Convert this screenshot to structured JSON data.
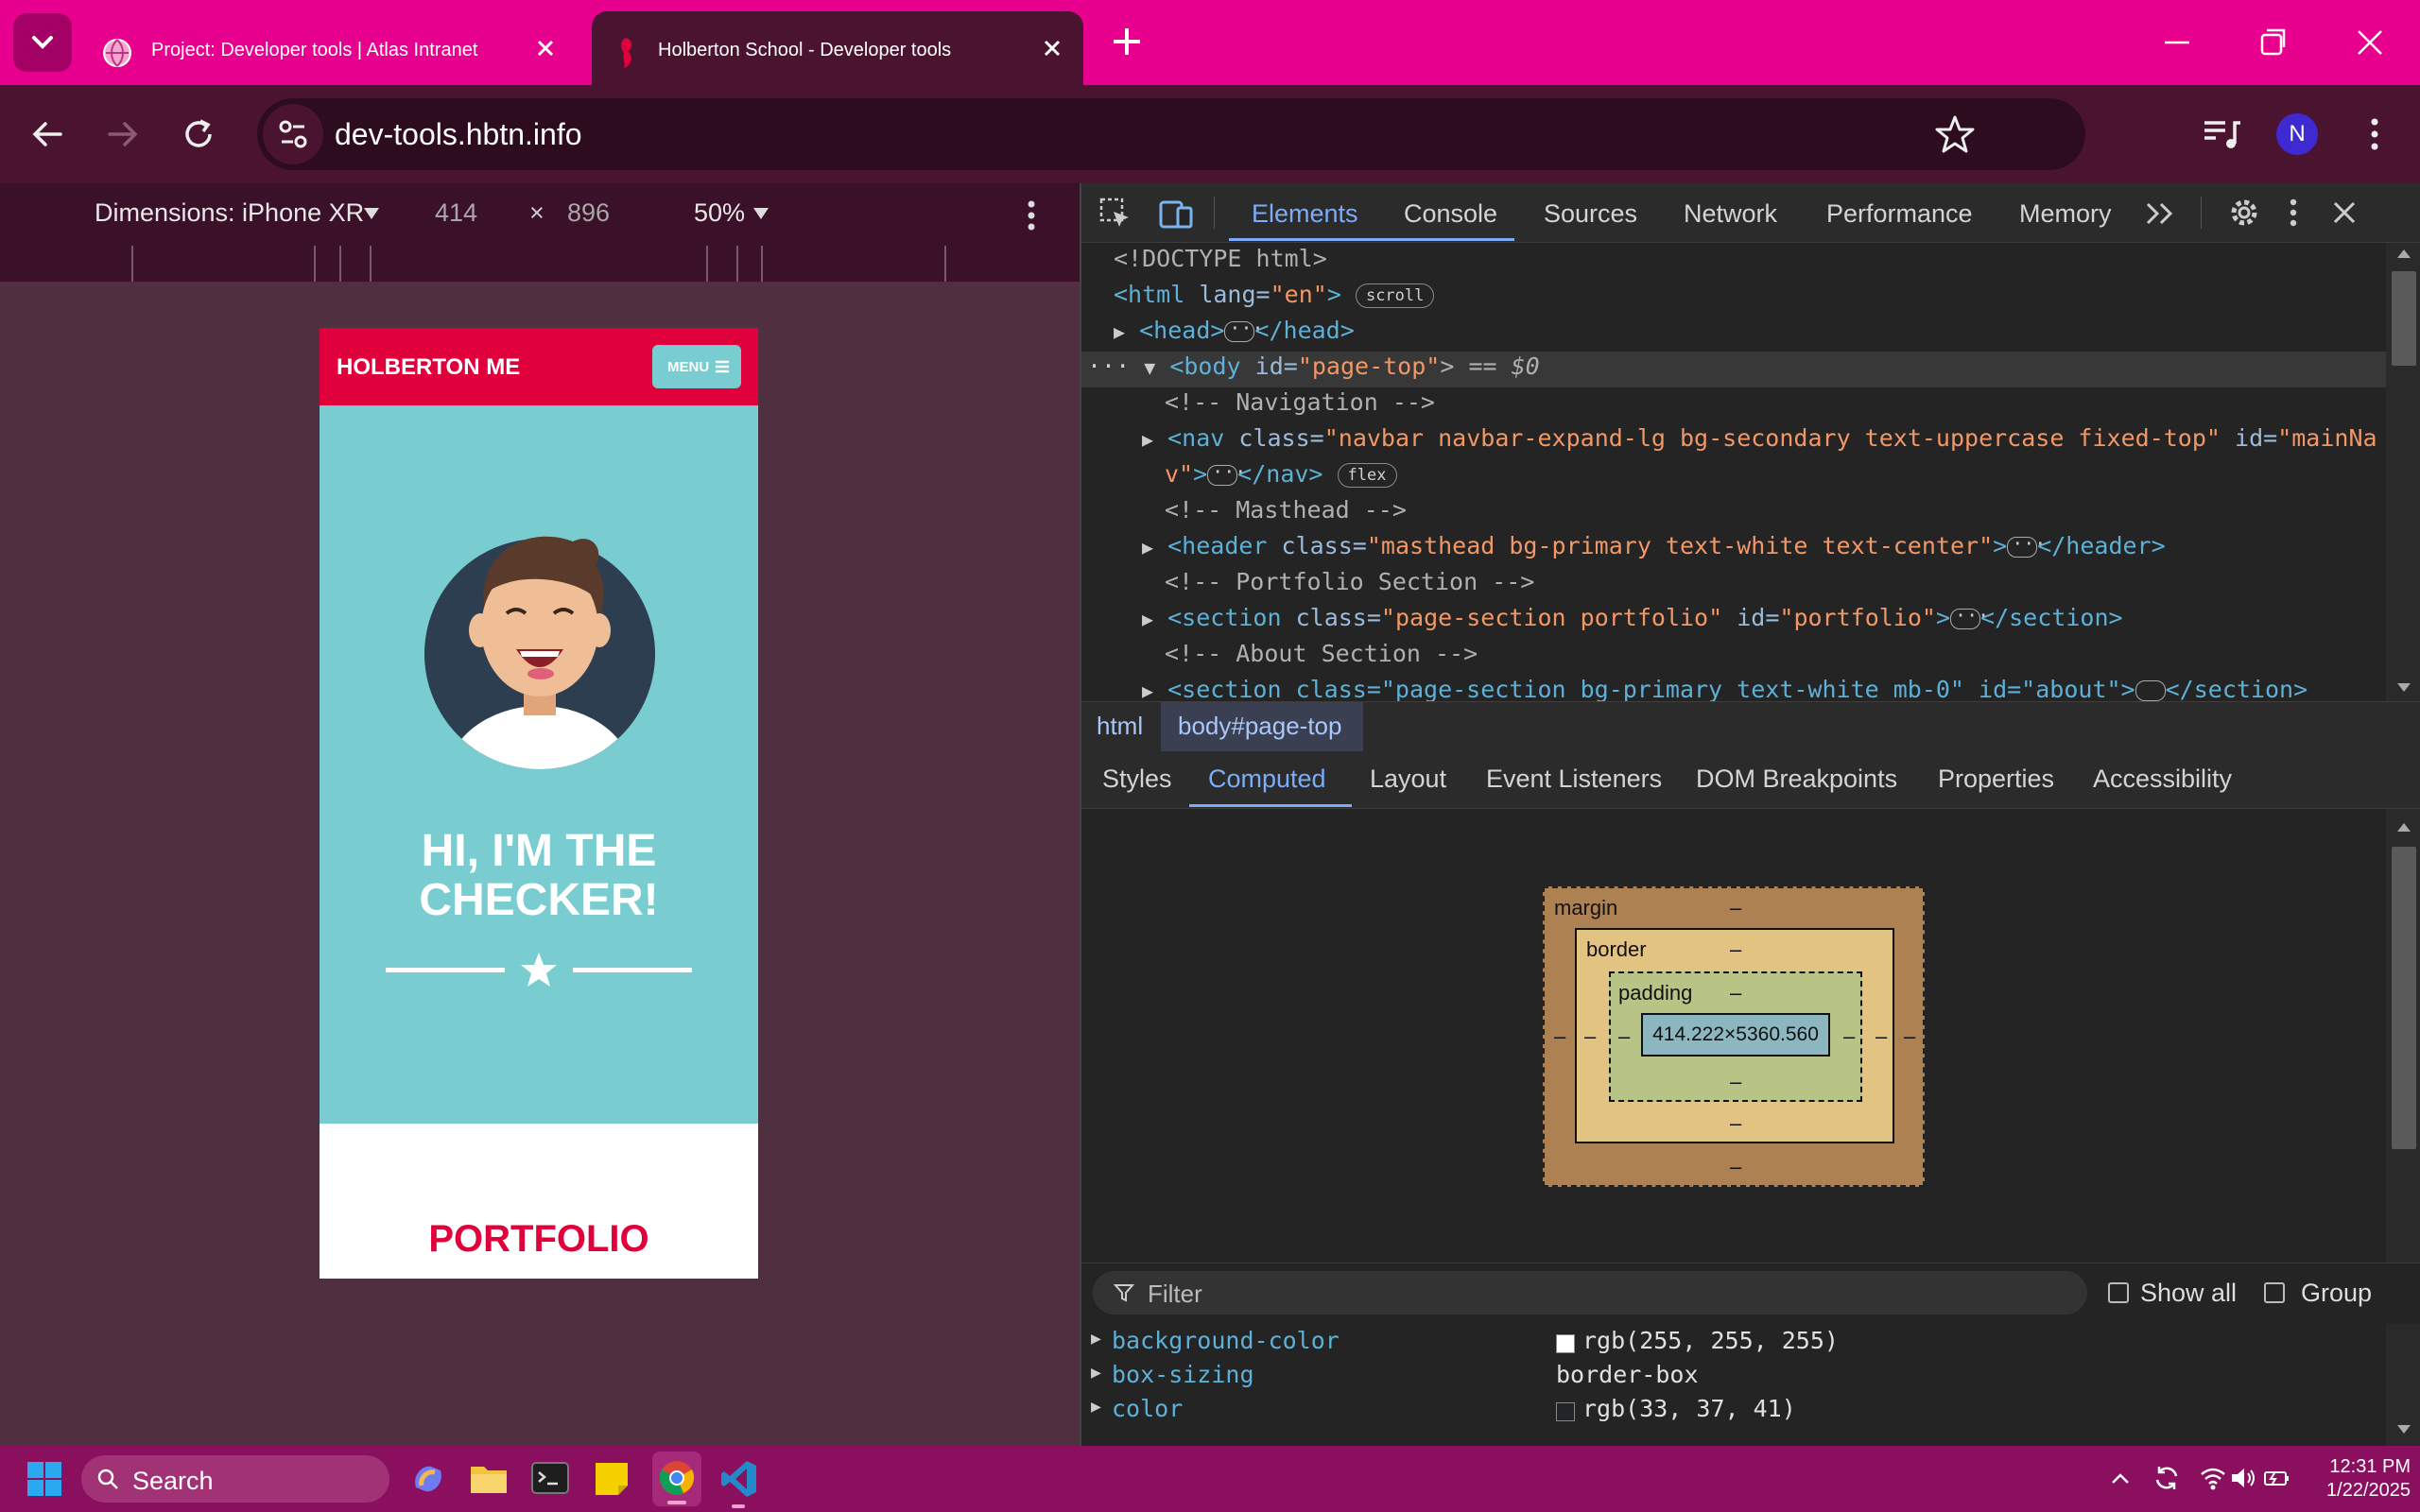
{
  "browser": {
    "tabs": [
      {
        "title": "Project: Developer tools | Atlas Intranet"
      },
      {
        "title": "Holberton School - Developer tools"
      }
    ],
    "url": "dev-tools.hbtn.info",
    "profile_initial": "N"
  },
  "device_toolbar": {
    "dimensions_label": "Dimensions: iPhone XR",
    "width": "414",
    "times": "×",
    "height": "896",
    "zoom": "50%"
  },
  "phone": {
    "brand": "HOLBERTON ME",
    "menu": "MENU",
    "hero_line1": "HI, I'M THE",
    "hero_line2": "CHECKER!",
    "portfolio": "PORTFOLIO"
  },
  "devtools": {
    "tabs": [
      "Elements",
      "Console",
      "Sources",
      "Network",
      "Performance",
      "Memory"
    ],
    "dom": {
      "doctype": "<!DOCTYPE html>",
      "html_open": "<html",
      "html_lang_attr": "lang",
      "html_lang_val": "\"en\"",
      "html_close": ">",
      "scroll_pill": "scroll",
      "head_open": "<head>",
      "head_close": "</head>",
      "body_open": "<body",
      "body_id_attr": "id",
      "body_id_val": "\"page-top\"",
      "body_tail": "> == $0",
      "c_nav": "<!-- Navigation -->",
      "nav_open": "<nav",
      "nav_class_attr": "class",
      "nav_class_val": "\"navbar navbar-expand-lg bg-secondary text-uppercase fixed-top\"",
      "nav_id_attr": "id",
      "nav_id_val_a": "\"mainNa",
      "nav_id_val_b": "v\"",
      "nav_close": "</nav>",
      "flex_pill": "flex",
      "c_masthead": "<!-- Masthead -->",
      "header_open": "<header",
      "header_class_attr": "class",
      "header_class_val": "\"masthead bg-primary text-white text-center\"",
      "header_close": "</header>",
      "c_portfolio": "<!-- Portfolio Section -->",
      "section_open": "<section",
      "section_class_attr": "class",
      "section_class_val": "\"page-section portfolio\"",
      "section_id_attr": "id",
      "section_id_val": "\"portfolio\"",
      "section_close": "</section>",
      "c_about": "<!-- About Section -->",
      "partial_line": "<section class=\"page-section bg-primary text-white mb-0\" id=\"about\">",
      "partial_close": "</section>"
    },
    "breadcrumbs": [
      "html",
      "body#page-top"
    ],
    "subtabs": [
      "Styles",
      "Computed",
      "Layout",
      "Event Listeners",
      "DOM Breakpoints",
      "Properties",
      "Accessibility"
    ],
    "box_model": {
      "margin_label": "margin",
      "border_label": "border",
      "padding_label": "padding",
      "dash": "–",
      "content_size": "414.222×5360.560"
    },
    "filter": {
      "placeholder": "Filter",
      "show_all": "Show all",
      "group": "Group"
    },
    "computed": [
      {
        "name": "background-color",
        "value": "rgb(255, 255, 255)",
        "swatch": "#ffffff"
      },
      {
        "name": "box-sizing",
        "value": "border-box"
      },
      {
        "name": "color",
        "value": "rgb(33, 37, 41)",
        "swatch": "#212529"
      }
    ]
  },
  "taskbar": {
    "search": "Search",
    "time": "12:31 PM",
    "date": "1/22/2025"
  },
  "colors": {
    "accent": "#e8008e",
    "phone_red": "#e0003c",
    "phone_teal": "#79ccd0"
  }
}
